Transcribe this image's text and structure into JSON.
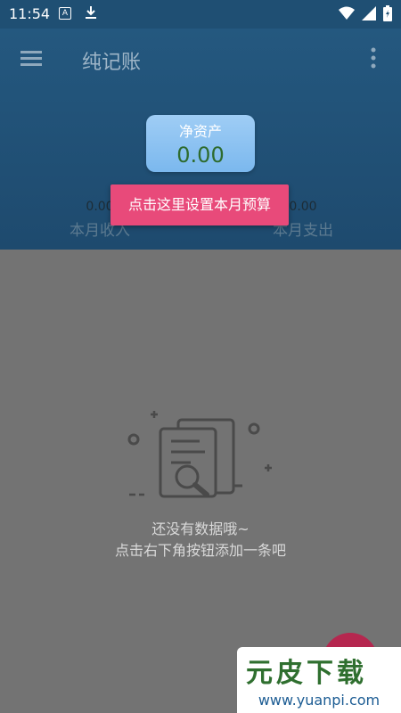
{
  "status_bar": {
    "time": "11:54",
    "badge": "A",
    "icons": [
      "keyboard-icon",
      "download-icon",
      "wifi-icon",
      "signal-icon",
      "battery-icon"
    ]
  },
  "toolbar": {
    "title": "纯记账"
  },
  "summary": {
    "net_assets_label": "净资产",
    "net_assets_value": "0.00",
    "income_value": "0.00",
    "income_label": "本月收入",
    "expense_value": "0.00",
    "expense_label": "本月支出"
  },
  "budget_prompt": "点击这里设置本月预算",
  "empty_state": {
    "line1": "还没有数据哦~",
    "line2": "点击右下角按钮添加一条吧"
  },
  "watermark": {
    "brand": "元皮下载",
    "url": "www.yuanpi.com"
  },
  "colors": {
    "header": "#1f4f73",
    "accent_pink": "#e84a7a",
    "fab": "#b5274f",
    "overlay": "#737373"
  }
}
